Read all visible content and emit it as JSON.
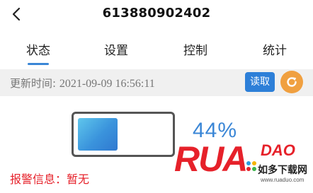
{
  "header": {
    "title": "613880902402"
  },
  "tabs": [
    {
      "label": "状态",
      "active": true
    },
    {
      "label": "设置",
      "active": false
    },
    {
      "label": "控制",
      "active": false
    },
    {
      "label": "统计",
      "active": false
    }
  ],
  "update": {
    "label": "更新时间: ",
    "value": "2021-09-09 16:56:11",
    "read_button": "读取"
  },
  "battery": {
    "level": 0.44,
    "percent_text": "44%"
  },
  "alarm": {
    "text": "报警信息：暂无"
  },
  "watermark": {
    "logo_text": "RUADAO",
    "site_cn": "如多下载网",
    "site_url": "www.ruaduo.com"
  },
  "colors": {
    "accent": "#3a86d6",
    "button": "#2d7fd8",
    "refresh": "#f0a040",
    "alarm": "#e6212a"
  }
}
